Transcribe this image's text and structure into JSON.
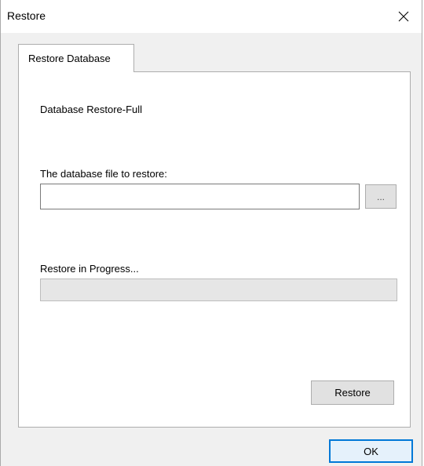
{
  "window": {
    "title": "Restore"
  },
  "tabs": [
    {
      "label": "Restore Database",
      "selected": true
    }
  ],
  "panel": {
    "heading": "Database Restore-Full",
    "file_label": "The database file to restore:",
    "file_value": "",
    "browse_label": "...",
    "progress_label": "Restore in Progress...",
    "progress_percent": 0,
    "restore_label": "Restore"
  },
  "footer": {
    "ok_label": "OK"
  },
  "colors": {
    "accent": "#0078d7",
    "progress_fill": "#06b025"
  },
  "icons": {
    "close": "close-icon"
  }
}
